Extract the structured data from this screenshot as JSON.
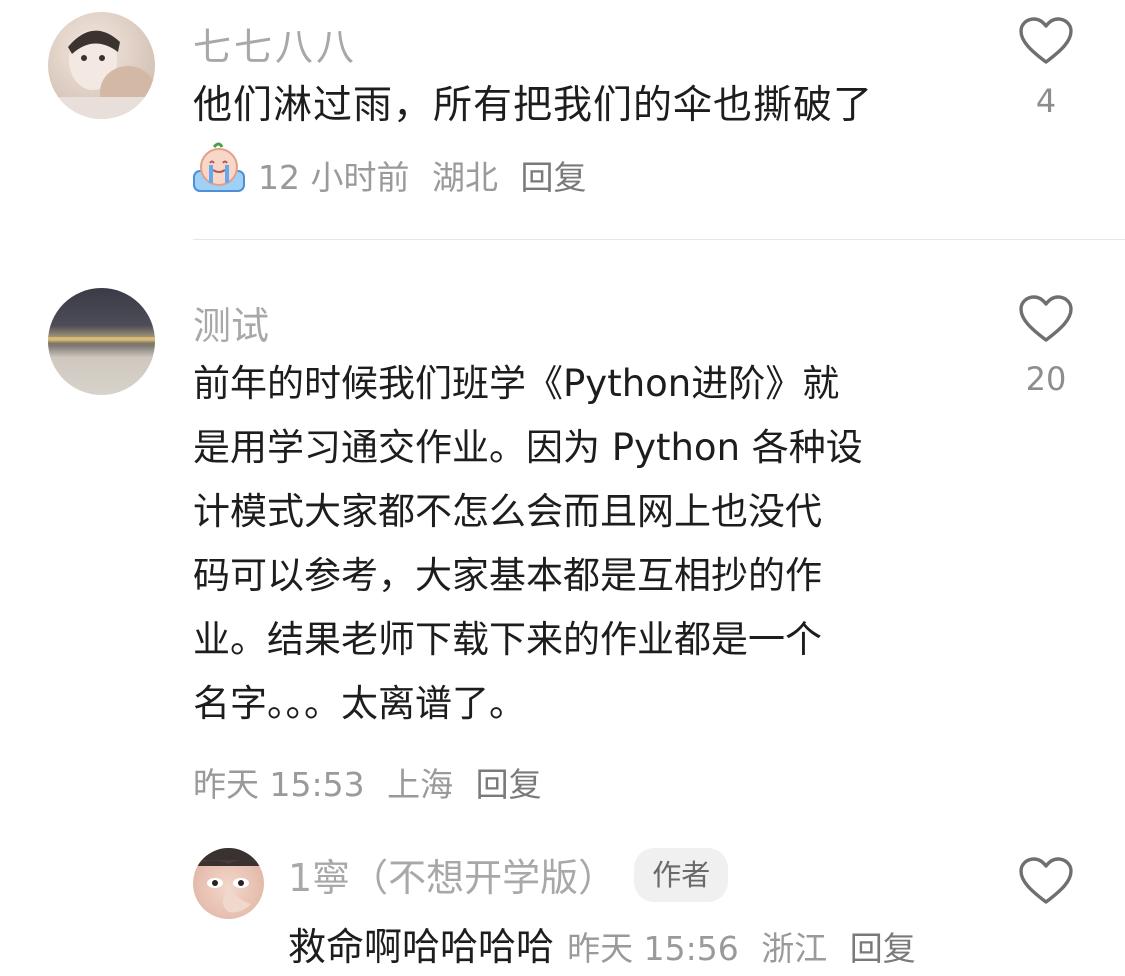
{
  "comments": [
    {
      "username": "七七八八",
      "content": "他们淋过雨，所有把我们的伞也撕破了",
      "sticker": "crying-peach-emoji",
      "time": "12 小时前",
      "location": "湖北",
      "reply_label": "回复",
      "likes": "4"
    },
    {
      "username": "测试",
      "content_lines": [
        "前年的时候我们班学《Python进阶》就",
        "是用学习通交作业。因为 Python 各种设",
        "计模式大家都不怎么会而且网上也没代",
        "码可以参考，大家基本都是互相抄的作",
        "业。结果老师下载下来的作业都是一个",
        "名字。。。太离谱了。"
      ],
      "time": "昨天 15:53",
      "location": "上海",
      "reply_label": "回复",
      "likes": "20",
      "replies": [
        {
          "username": "1寧（不想开学版）",
          "badge": "作者",
          "content": "救命啊哈哈哈哈",
          "time": "昨天 15:56",
          "location": "浙江",
          "reply_label": "回复"
        }
      ]
    }
  ],
  "icons": {
    "like": "heart-outline-icon"
  },
  "colors": {
    "username": "#a8a8a8",
    "content": "#1d1d1d",
    "meta": "#9a9a9a",
    "badge_bg": "#f0f0f0",
    "divider": "#e7e7e7"
  }
}
